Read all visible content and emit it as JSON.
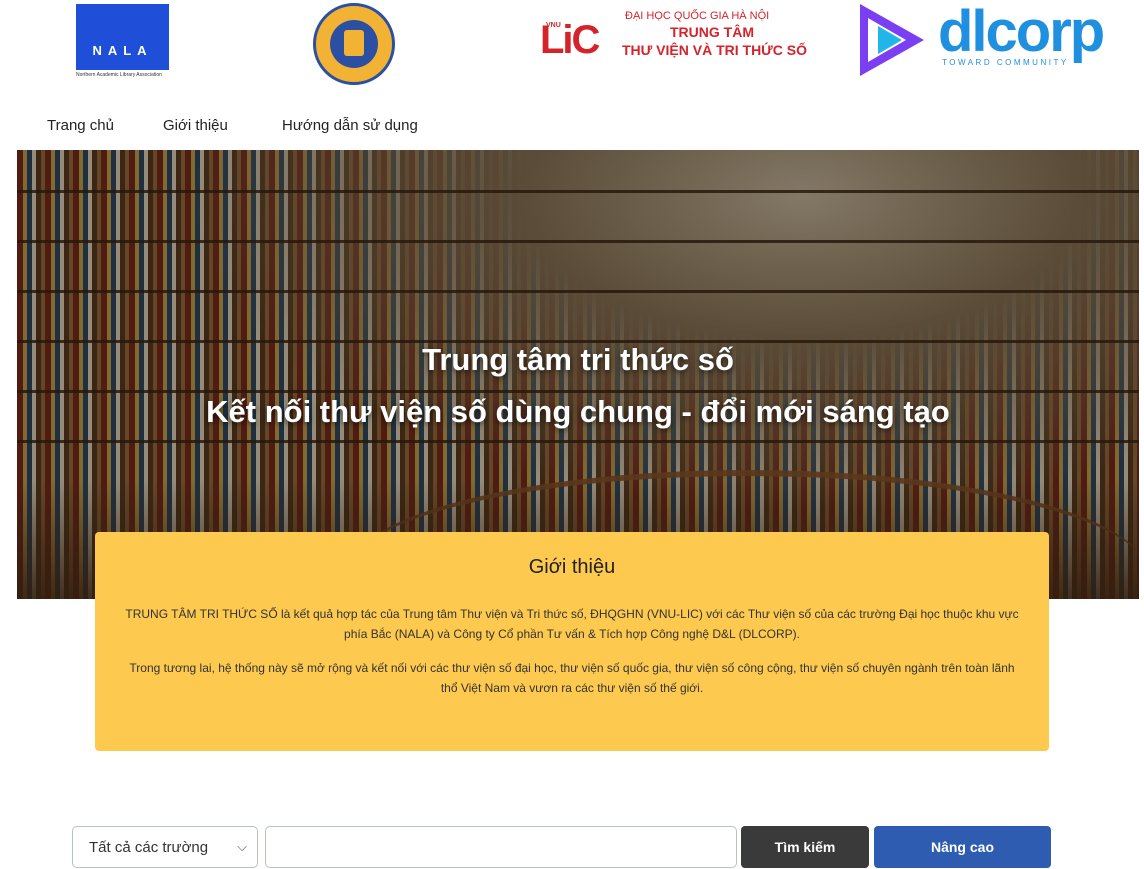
{
  "logos": {
    "nala": {
      "label": "NALA",
      "sub": "Northern Academic Library Association"
    },
    "lic": {
      "vnu": "VNU",
      "mark": "LiC",
      "line1": "ĐẠI HỌC QUỐC GIA HÀ NỘI",
      "line2": "TRUNG TÂM",
      "line3": "THƯ VIỆN VÀ TRI THỨC SỐ"
    },
    "dlcorp": {
      "word": "dlcorp",
      "tagline": "TOWARD COMMUNITY"
    }
  },
  "nav": {
    "items": [
      {
        "label": "Trang chủ"
      },
      {
        "label": "Giới thiệu"
      },
      {
        "label": "Hướng dẫn sử dụng"
      }
    ]
  },
  "hero": {
    "title_line1": "Trung tâm tri thức số",
    "title_line2": "Kết nối thư viện số dùng chung - đổi mới sáng tạo"
  },
  "intro": {
    "heading": "Giới thiệu",
    "paragraph1": "TRUNG TÂM TRI THỨC SỐ là kết quả hợp tác của Trung tâm Thư viện và Tri thức số, ĐHQGHN (VNU-LIC) với các Thư viện số của các trường Đại học thuộc khu vực phía Bắc (NALA) và Công ty Cổ phần Tư vấn & Tích hợp Công nghệ D&L (DLCORP).",
    "paragraph2": "Trong tương lai, hệ thống này sẽ mở rộng và kết nối với các thư viện số đại học, thư viện số quốc gia, thư viện số công cộng, thư viện số chuyên ngành trên toàn lãnh thổ Việt Nam và vươn ra các thư viện số thế giới."
  },
  "search": {
    "scope_selected": "Tất cả các trường",
    "query": "",
    "placeholder": "",
    "search_button": "Tìm kiếm",
    "advanced_button": "Nâng cao"
  },
  "colors": {
    "intro_bg": "#fdc94e",
    "search_button_bg": "#3a3a3a",
    "advanced_button_bg": "#2e5cb0"
  }
}
